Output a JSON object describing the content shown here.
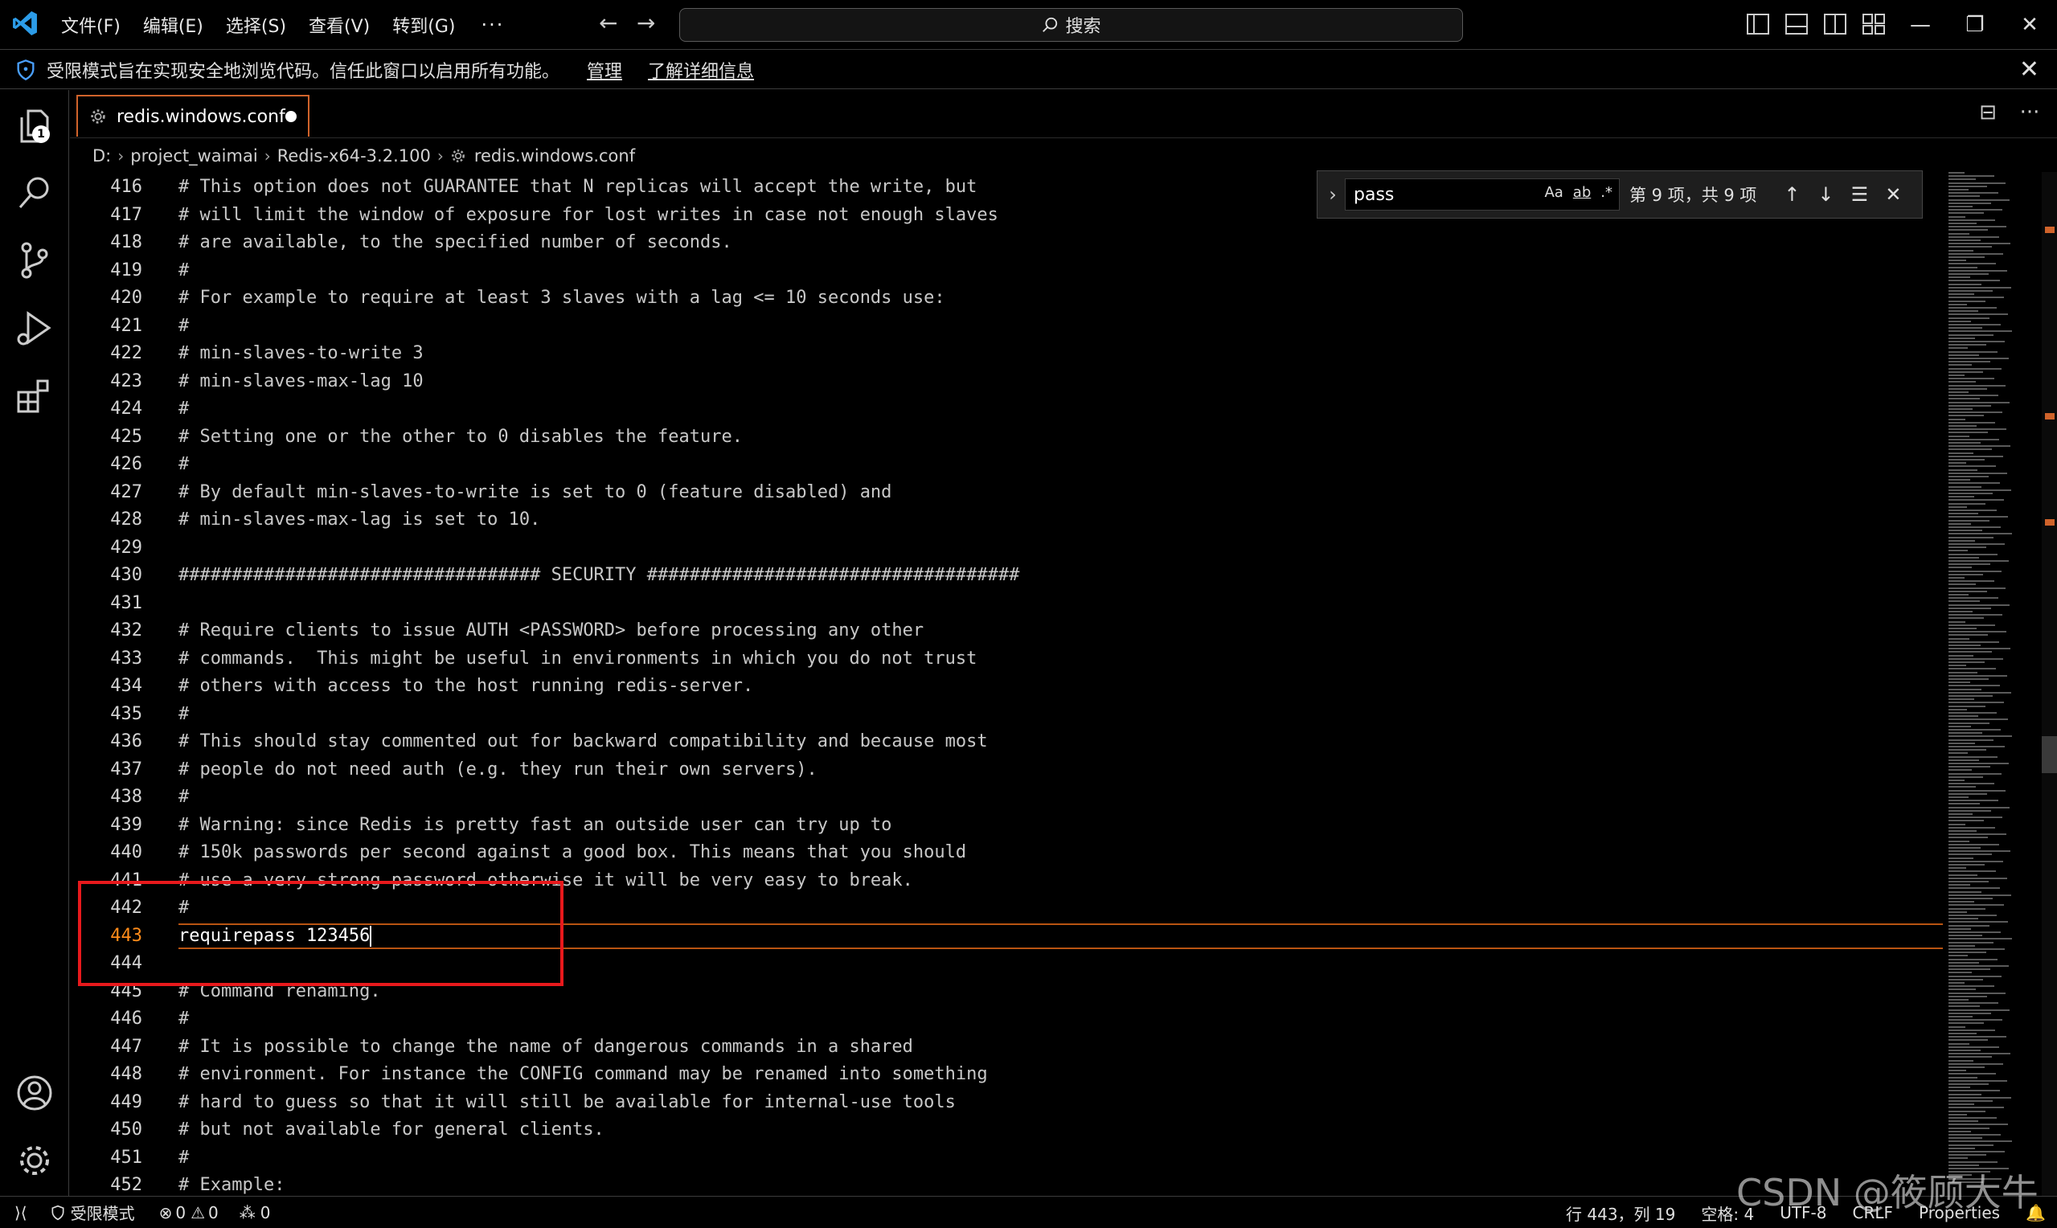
{
  "titlebar": {
    "menu": [
      "文件(F)",
      "编辑(E)",
      "选择(S)",
      "查看(V)",
      "转到(G)"
    ],
    "more": "···",
    "back": "←",
    "forward": "→",
    "search_label": "搜索",
    "window": {
      "minimize": "—",
      "restore": "❐",
      "close": "✕"
    }
  },
  "banner": {
    "message": "受限模式旨在实现安全地浏览代码。信任此窗口以启用所有功能。",
    "manage": "管理",
    "learn_more": "了解详细信息",
    "close": "✕"
  },
  "activity_bar": {
    "explorer_badge": "1",
    "icons": [
      "files-icon",
      "search-icon",
      "source-control-icon",
      "run-debug-icon",
      "extensions-icon",
      "account-icon",
      "settings-gear-icon"
    ]
  },
  "tab": {
    "name": "redis.windows.conf",
    "modified": true
  },
  "tab_actions": {
    "split": "⊟",
    "more": "···"
  },
  "breadcrumb": [
    "D:",
    "project_waimai",
    "Redis-x64-3.2.100",
    "redis.windows.conf"
  ],
  "find": {
    "query": "pass",
    "match_case": "Aa",
    "whole_word": "ab",
    "regex": ".*",
    "count": "第 9 项，共 9 项",
    "toggle": "›",
    "prev": "↑",
    "next": "↓",
    "selection": "☰",
    "close": "✕"
  },
  "editor": {
    "current_line": 443,
    "lines": [
      {
        "n": "416",
        "text": "# This option does not GUARANTEE that N replicas will accept the write, but"
      },
      {
        "n": "417",
        "text": "# will limit the window of exposure for lost writes in case not enough slaves"
      },
      {
        "n": "418",
        "text": "# are available, to the specified number of seconds."
      },
      {
        "n": "419",
        "text": "#"
      },
      {
        "n": "420",
        "text": "# For example to require at least 3 slaves with a lag <= 10 seconds use:"
      },
      {
        "n": "421",
        "text": "#"
      },
      {
        "n": "422",
        "text": "# min-slaves-to-write 3"
      },
      {
        "n": "423",
        "text": "# min-slaves-max-lag 10"
      },
      {
        "n": "424",
        "text": "#"
      },
      {
        "n": "425",
        "text": "# Setting one or the other to 0 disables the feature."
      },
      {
        "n": "426",
        "text": "#"
      },
      {
        "n": "427",
        "text": "# By default min-slaves-to-write is set to 0 (feature disabled) and"
      },
      {
        "n": "428",
        "text": "# min-slaves-max-lag is set to 10."
      },
      {
        "n": "429",
        "text": ""
      },
      {
        "n": "430",
        "text": "################################## SECURITY ###################################"
      },
      {
        "n": "431",
        "text": ""
      },
      {
        "n": "432",
        "text": "# Require clients to issue AUTH <PASSWORD> before processing any other"
      },
      {
        "n": "433",
        "text": "# commands.  This might be useful in environments in which you do not trust"
      },
      {
        "n": "434",
        "text": "# others with access to the host running redis-server."
      },
      {
        "n": "435",
        "text": "#"
      },
      {
        "n": "436",
        "text": "# This should stay commented out for backward compatibility and because most"
      },
      {
        "n": "437",
        "text": "# people do not need auth (e.g. they run their own servers)."
      },
      {
        "n": "438",
        "text": "#"
      },
      {
        "n": "439",
        "text": "# Warning: since Redis is pretty fast an outside user can try up to"
      },
      {
        "n": "440",
        "text": "# 150k passwords per second against a good box. This means that you should"
      },
      {
        "n": "441",
        "text": "# use a very strong password otherwise it will be very easy to break."
      },
      {
        "n": "442",
        "text": "#"
      },
      {
        "n": "443",
        "text": "requirepass 123456"
      },
      {
        "n": "444",
        "text": ""
      },
      {
        "n": "445",
        "text": "# Command renaming."
      },
      {
        "n": "446",
        "text": "#"
      },
      {
        "n": "447",
        "text": "# It is possible to change the name of dangerous commands in a shared"
      },
      {
        "n": "448",
        "text": "# environment. For instance the CONFIG command may be renamed into something"
      },
      {
        "n": "449",
        "text": "# hard to guess so that it will still be available for internal-use tools"
      },
      {
        "n": "450",
        "text": "# but not available for general clients."
      },
      {
        "n": "451",
        "text": "#"
      },
      {
        "n": "452",
        "text": "# Example:"
      }
    ]
  },
  "statusbar": {
    "remote": "⟩⟨",
    "restricted": "受限模式",
    "errors": "0",
    "warnings": "0",
    "ports": "0",
    "position": "行 443，列 19",
    "spaces": "空格: 4",
    "encoding": "UTF-8",
    "eol": "CRLF",
    "language": "Properties",
    "notifications": "🔔"
  },
  "watermark": "CSDN @筱顾大牛",
  "colors": {
    "accent": "#d0632b",
    "highlight_box": "#e8191c",
    "active_line_number": "#ff8c1a"
  }
}
